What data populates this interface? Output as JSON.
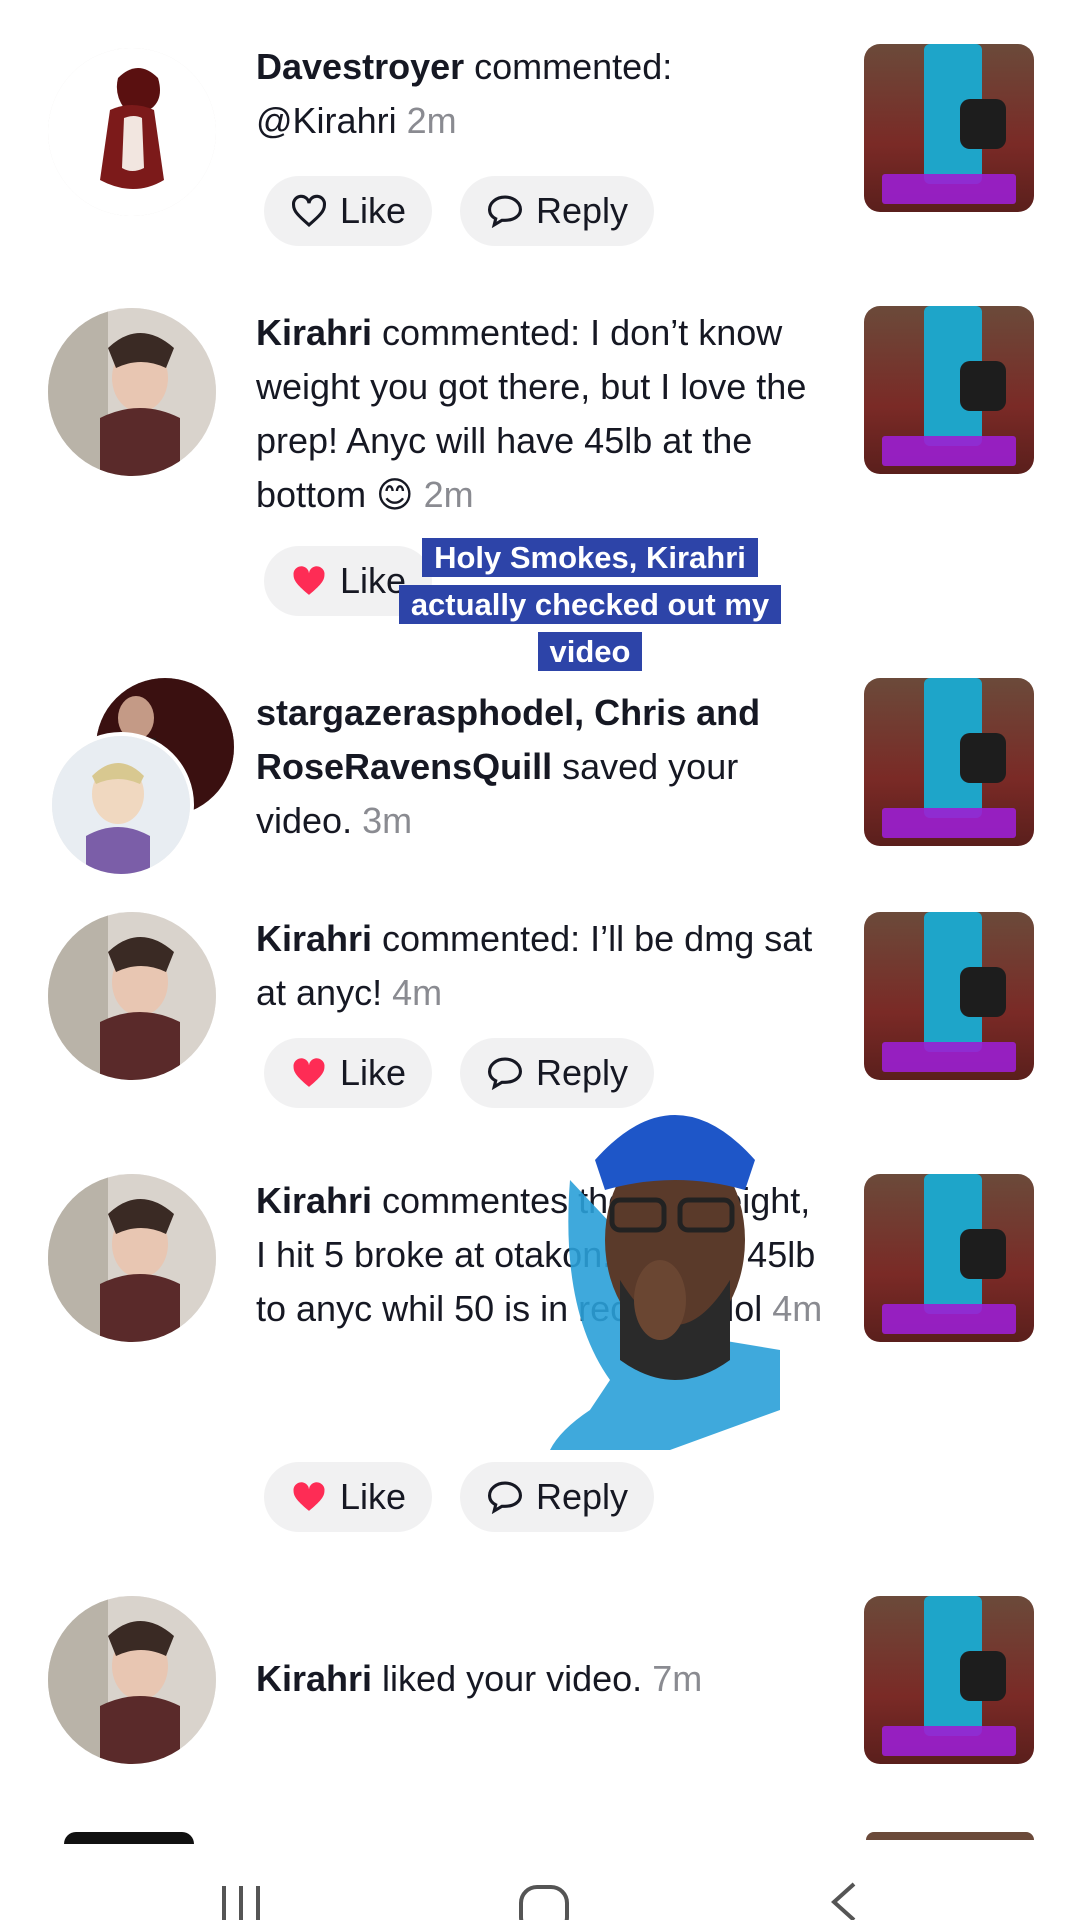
{
  "notifications": [
    {
      "user": "Davestroyer",
      "action": " commented: ",
      "message": "@Kirahri",
      "time": "2m",
      "show_actions": true,
      "liked": false,
      "like_label": "Like",
      "reply_label": "Reply"
    },
    {
      "user": "Kirahri",
      "action": " commented: ",
      "message": "I don’t know weight you got there, but I love the prep! Anyc will have 45lb at the bottom 😊",
      "time": "2m",
      "show_actions": true,
      "liked": true,
      "like_label": "Like",
      "reply_label": "Reply"
    },
    {
      "user": "stargazerasphodel, Chris and RoseRavensQuill",
      "action": " saved your video.",
      "message": "",
      "time": "3m",
      "show_actions": false
    },
    {
      "user": "Kirahri",
      "action": " commented: ",
      "message": "I’ll be dmg sat at anyc!",
      "time": "4m",
      "show_actions": true,
      "liked": true,
      "like_label": "Like",
      "reply_label": "Reply"
    },
    {
      "user": "Kirahri",
      "action": " commente",
      "message": "s the old weight, I hit 5 broke at otakon. I' nging 45lb to anyc whil 50 is in recovery lol",
      "time": "4m",
      "show_actions": true,
      "liked": true,
      "like_label": "Like",
      "reply_label": "Reply"
    },
    {
      "user": "Kirahri",
      "action": " liked your video.",
      "message": "",
      "time": "7m",
      "show_actions": false
    }
  ],
  "overlay_caption": "Holy Smokes, Kirahri actually checked out my video",
  "colors": {
    "heart_liked": "#fe2c55",
    "caption_bg": "#2d44a8",
    "pill_bg": "#f1f1f2"
  },
  "icons": {
    "like": "heart-icon",
    "reply": "speech-bubble-icon",
    "nav_recent": "recent-apps-icon",
    "nav_home": "home-icon",
    "nav_back": "back-icon"
  }
}
